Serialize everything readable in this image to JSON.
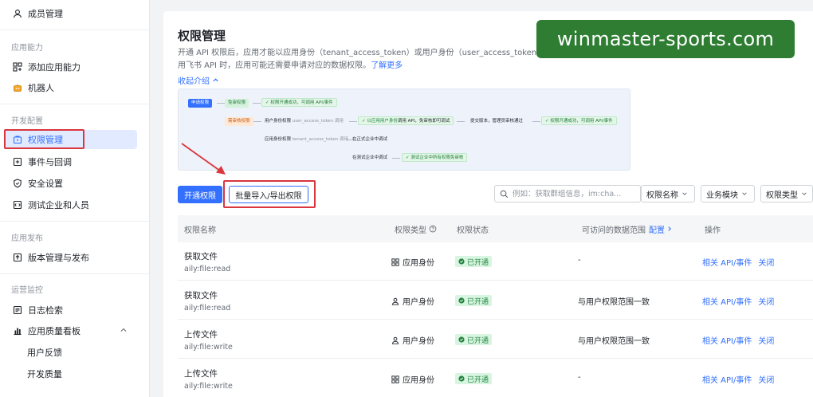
{
  "sidebar": {
    "items": [
      {
        "label": "成员管理",
        "icon": "user-icon"
      },
      {
        "label": "添加应用能力",
        "icon": "apps-add-icon"
      },
      {
        "label": "机器人",
        "icon": "robot-icon"
      },
      {
        "label": "权限管理",
        "icon": "permission-icon"
      },
      {
        "label": "事件与回调",
        "icon": "event-icon"
      },
      {
        "label": "安全设置",
        "icon": "shield-icon"
      },
      {
        "label": "测试企业和人员",
        "icon": "test-icon"
      },
      {
        "label": "版本管理与发布",
        "icon": "upload-icon"
      },
      {
        "label": "日志检索",
        "icon": "log-icon"
      },
      {
        "label": "应用质量看板",
        "icon": "chart-icon"
      },
      {
        "label": "用户反馈"
      },
      {
        "label": "开发质量"
      }
    ],
    "groups": [
      "应用能力",
      "开发配置",
      "应用发布",
      "运营监控"
    ]
  },
  "header": {
    "title": "权限管理",
    "desc_line1": "开通 API 权限后，应用才能以应用身份（tenant_access_token）或用户身份（user_access_token）调用",
    "desc_line2": "用飞书 API 时，应用可能还需要申请对应的数据权限。",
    "learn_more": "了解更多",
    "collapse": "收起介绍"
  },
  "flow": {
    "apply": "申请权限",
    "free": "免审权限",
    "free_result": "权限开通成功，可调用 API/事件",
    "review": "需审核权限",
    "user_identity": "用户身份权限",
    "user_token": "user_access_token 调用",
    "user_scope": "以应用用户身份",
    "user_call": "调用 API，免审核即可调试",
    "submit": "提交版本，管理员审核通过",
    "success": "权限开通成功，可调用 API/事件",
    "app_identity": "应用身份权限",
    "tenant_token": "tenant_access_token 调用",
    "prod_debug": "在正式企业中调试",
    "test_debug": "在测试企业中调试",
    "test_result": "测试企业中所有权限免审核"
  },
  "toolbar": {
    "enable": "开通权限",
    "import_export": "批量导入/导出权限",
    "search_placeholder": "例如：获取群组信息，im:cha...",
    "filters": [
      "权限名称",
      "业务模块",
      "权限类型"
    ]
  },
  "table": {
    "headers": {
      "name": "权限名称",
      "type": "权限类型",
      "status": "权限状态",
      "scope": "可访问的数据范围",
      "configure": "配置",
      "action": "操作"
    },
    "rows": [
      {
        "title": "获取文件",
        "key": "aily:file:read",
        "type": "应用身份",
        "type_icon": "grid-icon",
        "status": "已开通",
        "scope": "-",
        "related": "相关 API/事件",
        "close": "关闭"
      },
      {
        "title": "获取文件",
        "key": "aily:file:read",
        "type": "用户身份",
        "type_icon": "person-icon",
        "status": "已开通",
        "scope": "与用户权限范围一致",
        "related": "相关 API/事件",
        "close": "关闭"
      },
      {
        "title": "上传文件",
        "key": "aily:file:write",
        "type": "用户身份",
        "type_icon": "person-icon",
        "status": "已开通",
        "scope": "与用户权限范围一致",
        "related": "相关 API/事件",
        "close": "关闭"
      },
      {
        "title": "上传文件",
        "key": "aily:file:write",
        "type": "应用身份",
        "type_icon": "grid-icon",
        "status": "已开通",
        "scope": "-",
        "related": "相关 API/事件",
        "close": "关闭"
      }
    ]
  },
  "watermark": "winmaster-sports.com",
  "colors": {
    "accent": "#3370ff",
    "success": "#23843f",
    "annotation": "#d9363e",
    "watermark_bg": "#2e7d32"
  }
}
